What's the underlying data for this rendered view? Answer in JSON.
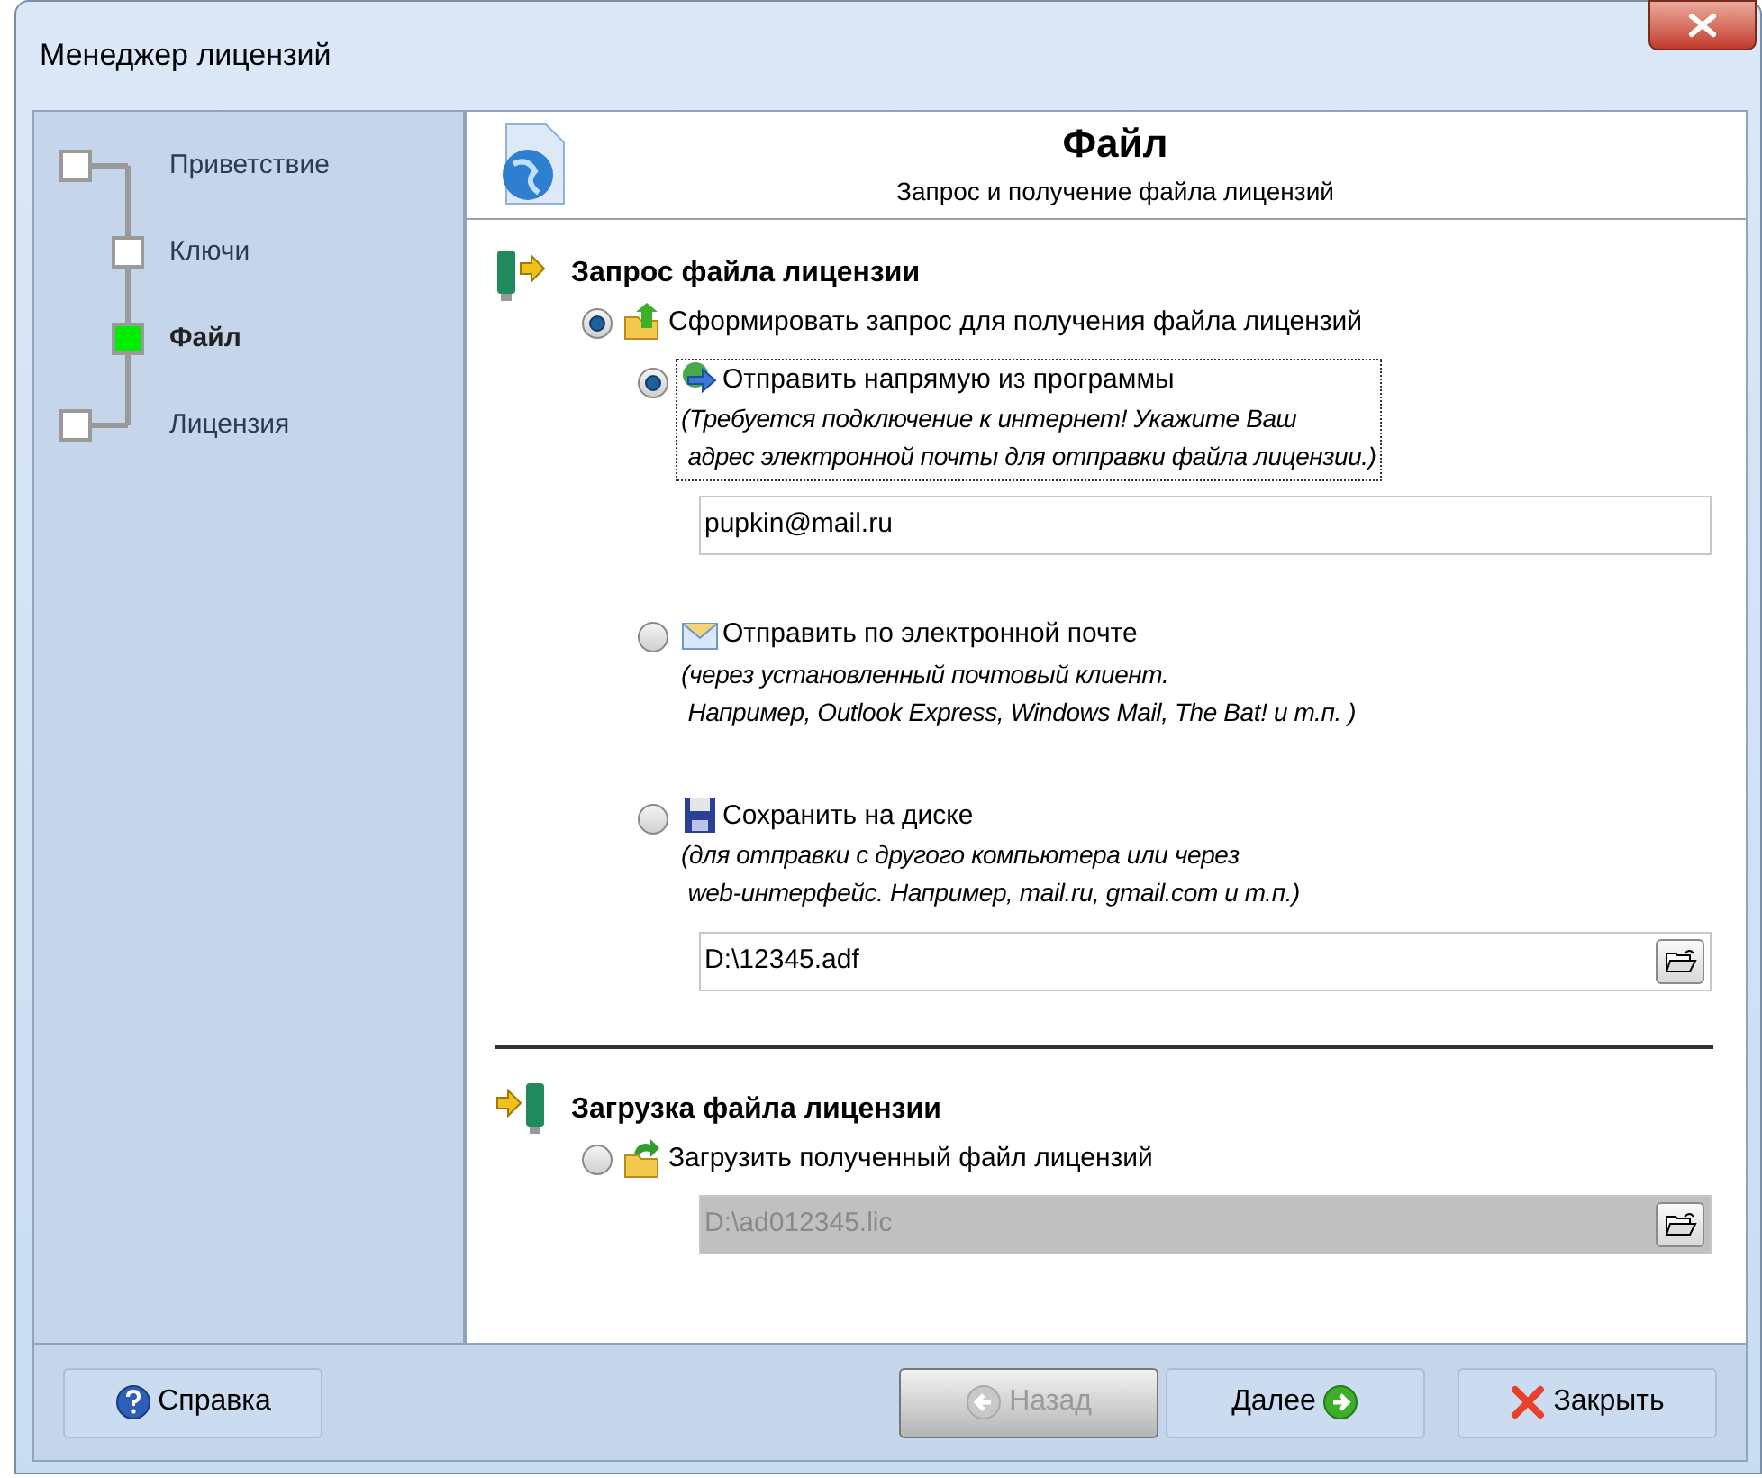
{
  "window": {
    "title": "Менеджер лицензий"
  },
  "steps": [
    {
      "label": "Приветствие",
      "selected": false,
      "children": [
        {
          "label": "Ключи",
          "selected": false
        },
        {
          "label": "Файл",
          "selected": true
        }
      ]
    },
    {
      "label": "Лицензия",
      "selected": false
    }
  ],
  "header": {
    "title": "Файл",
    "subtitle": "Запрос и получение файла лицензий"
  },
  "sections": [
    {
      "kind": "request",
      "title": "Запрос файла лицензии",
      "options": [
        {
          "kind": "request",
          "label": "Сформировать запрос для получения файла лицензий",
          "selected": true,
          "children": [
            {
              "kind": "direct",
              "label": "Отправить напрямую из программы",
              "note": "(Требуется подключение к интернет! Укажите Ваш\n адрес электронной почты для отправки файла лицензии.)",
              "selected": true,
              "focused": true,
              "field": {
                "value": "pupkin@mail.ru",
                "disabled": false
              }
            },
            {
              "kind": "email",
              "label": "Отправить по электронной почте",
              "note": "(через установленный почтовый клиент.\n Например, Outlook Express, Windows Mail, The Bat! и т.п. )",
              "selected": false,
              "focused": false
            },
            {
              "kind": "disk",
              "label": "Сохранить на диске",
              "note": "(для отправки с другого компьютера или через\n web-интерфейс. Например, mail.ru, gmail.com и т.п.)",
              "selected": false,
              "focused": false,
              "field": {
                "value": "D:\\12345.adf",
                "disabled": false,
                "browse": true
              }
            }
          ]
        }
      ]
    },
    {
      "kind": "load",
      "title": "Загрузка файла лицензии",
      "options": [
        {
          "kind": "load",
          "label": "Загрузить полученный файл лицензий",
          "selected": false,
          "field": {
            "value": "D:\\ad012345.lic",
            "disabled": true,
            "browse": true
          }
        }
      ]
    }
  ],
  "buttons": [
    {
      "kind": "help",
      "label": "Справка",
      "disabled": false
    },
    {
      "kind": "back",
      "label": "Назад",
      "disabled": true
    },
    {
      "kind": "next",
      "label": "Далее",
      "disabled": false
    },
    {
      "kind": "close",
      "label": "Закрыть",
      "disabled": false
    }
  ]
}
